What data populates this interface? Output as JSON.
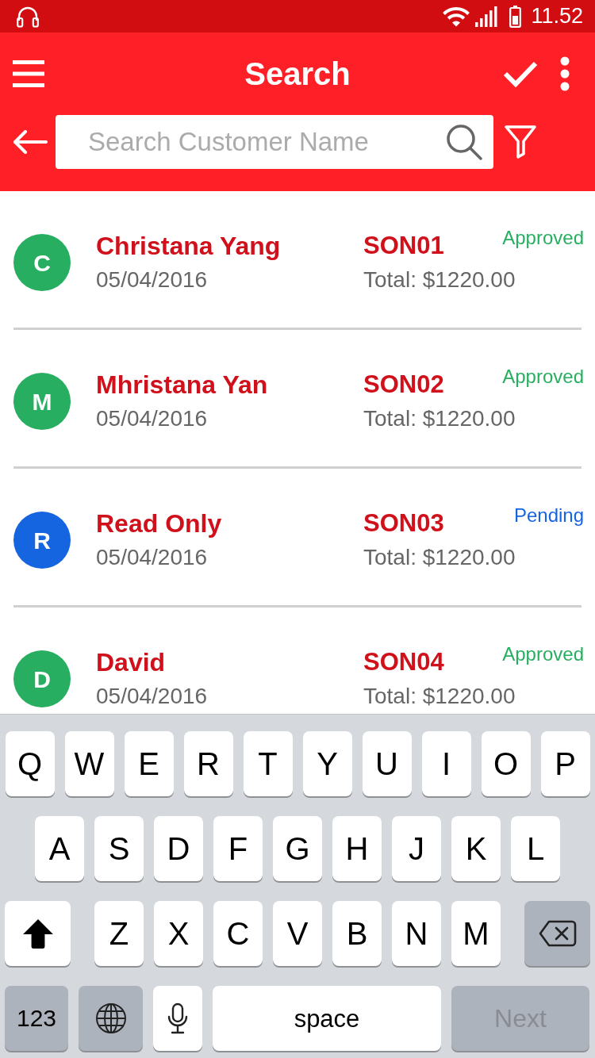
{
  "status_bar": {
    "time": "11.52"
  },
  "app_bar": {
    "title": "Search"
  },
  "search": {
    "placeholder": "Search Customer Name"
  },
  "orders": [
    {
      "initial": "C",
      "name": "Christana Yang",
      "date": "05/04/2016",
      "order_number": "SON01",
      "total": "Total: $1220.00",
      "status": "Approved",
      "color": "#27ae60"
    },
    {
      "initial": "M",
      "name": "Mhristana Yan",
      "date": "05/04/2016",
      "order_number": "SON02",
      "total": "Total: $1220.00",
      "status": "Approved",
      "color": "#27ae60"
    },
    {
      "initial": "R",
      "name": "Read Only",
      "date": "05/04/2016",
      "order_number": "SON03",
      "total": "Total: $1220.00",
      "status": "Pending",
      "color": "#1565e0"
    },
    {
      "initial": "D",
      "name": "David",
      "date": "05/04/2016",
      "order_number": "SON04",
      "total": "Total: $1220.00",
      "status": "Approved",
      "color": "#27ae60"
    }
  ],
  "keyboard": {
    "letter_rows": [
      [
        "Q",
        "W",
        "E",
        "R",
        "T",
        "Y",
        "U",
        "I",
        "O",
        "P"
      ],
      [
        "A",
        "S",
        "D",
        "F",
        "G",
        "H",
        "J",
        "K",
        "L"
      ],
      [
        "Z",
        "X",
        "C",
        "V",
        "B",
        "N",
        "M"
      ]
    ],
    "shift": {
      "on": true
    },
    "numbers_key": "123",
    "space_key": "space",
    "return_key": {
      "label": "Next",
      "disabled": true
    }
  }
}
